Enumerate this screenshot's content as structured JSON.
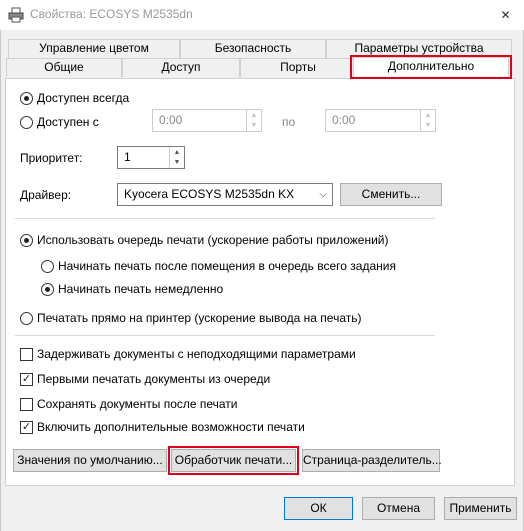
{
  "window": {
    "title": "Свойства: ECOSYS M2535dn",
    "close_glyph": "✕"
  },
  "tabs": {
    "row_back": [
      "Управление цветом",
      "Безопасность",
      "Параметры устройства"
    ],
    "row_front": [
      "Общие",
      "Доступ",
      "Порты",
      "Дополнительно"
    ],
    "selected": "Дополнительно"
  },
  "availability": {
    "always_label": "Доступен всегда",
    "from_label": "Доступен с",
    "from_time": "0:00",
    "to_label": "по",
    "to_time": "0:00",
    "selected": "always"
  },
  "priority": {
    "label": "Приоритет:",
    "value": "1"
  },
  "driver": {
    "label": "Драйвер:",
    "value": "Kyocera ECOSYS M2535dn KX",
    "change_button": "Сменить..."
  },
  "spooling": {
    "use_queue_label": "Использовать очередь печати (ускорение работы приложений)",
    "start_after_last_label": "Начинать печать после помещения в очередь всего задания",
    "start_immediately_label": "Начинать печать немедленно",
    "direct_label": "Печатать прямо на принтер (ускорение вывода на печать)",
    "mode": "queue",
    "start": "immediately"
  },
  "options": [
    {
      "label": "Задерживать документы с неподходящими параметрами",
      "checked": false
    },
    {
      "label": "Первыми печатать документы из очереди",
      "checked": true
    },
    {
      "label": "Сохранять документы после печати",
      "checked": false
    },
    {
      "label": "Включить дополнительные возможности печати",
      "checked": true
    }
  ],
  "panel_buttons": {
    "defaults": "Значения по умолчанию...",
    "print_processor": "Обработчик печати...",
    "separator_page": "Страница-разделитель..."
  },
  "dialog_buttons": {
    "ok": "ОК",
    "cancel": "Отмена",
    "apply": "Применить"
  },
  "icons": {
    "window": "printer-icon",
    "dropdown": "chevron-down-icon",
    "spin_up": "spin-up-icon",
    "spin_down": "spin-down-icon",
    "check": "checkmark-icon"
  },
  "colors": {
    "highlight": "#e0001b"
  }
}
